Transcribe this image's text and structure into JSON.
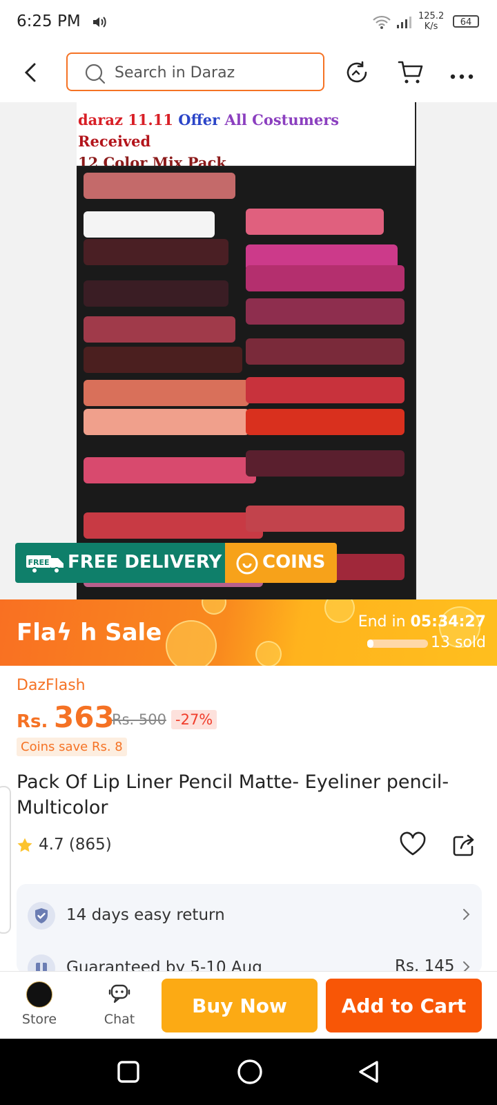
{
  "status_bar": {
    "time": "6:25 PM",
    "net_speed_value": "125.2",
    "net_speed_unit": "K/s",
    "battery": "64"
  },
  "header": {
    "search_placeholder": "Search in Daraz"
  },
  "hero": {
    "banner_parts": [
      {
        "text": "daraz 11.11 ",
        "color": "#d81f26"
      },
      {
        "text": "Offer ",
        "color": "#2b45c8"
      },
      {
        "text": "All Costumers ",
        "color": "#8b3fbf"
      },
      {
        "text": "Received",
        "color": "#b3141b"
      }
    ],
    "banner_line2": "12 Color Mix Pack",
    "banner_line2_color": "#8b1a1a",
    "badge_free_delivery": "FREE DELIVERY",
    "badge_free_icon_text": "FREE",
    "badge_coins": "COINS"
  },
  "flash_sale": {
    "title": "Flaϟ h  Sale",
    "end_label": "End in ",
    "countdown": "05:34:27",
    "sold": "13 sold",
    "sold_fraction": 0.1
  },
  "product": {
    "tag": "DazFlash",
    "currency": "Rs.",
    "price": "363",
    "old_price": "Rs. 500",
    "discount": "-27%",
    "coins_save": "Coins save Rs. 8",
    "title": "Pack Of Lip Liner Pencil Matte- Eyeliner pencil- Multicolor",
    "rating": "4.7",
    "reviews": "(865)"
  },
  "services": [
    {
      "label": "14 days easy return",
      "icon": "shield-check-icon",
      "fee": ""
    },
    {
      "label": "Guaranteed by 5-10 Aug",
      "icon": "delivery-icon",
      "fee": "Rs. 145"
    }
  ],
  "bottom_bar": {
    "store_label": "Store",
    "chat_label": "Chat",
    "buy_now": "Buy Now",
    "add_to_cart": "Add to Cart"
  },
  "colors": {
    "accent": "#f57224",
    "buy_now": "#fcaa14",
    "add_to_cart": "#f85606",
    "free_delivery": "#0f7f6a",
    "coins": "#f7a21a"
  }
}
